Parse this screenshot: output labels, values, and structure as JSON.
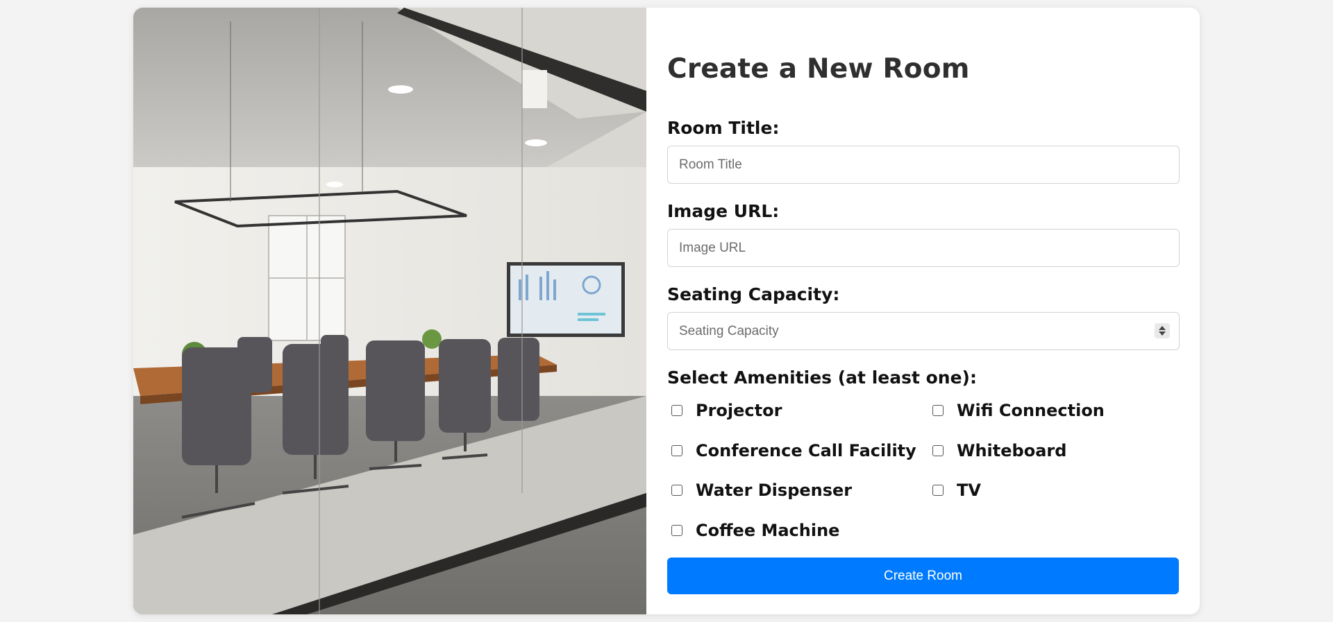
{
  "form": {
    "title": "Create a New Room",
    "room_title_label": "Room Title:",
    "room_title_placeholder": "Room Title",
    "image_url_label": "Image URL:",
    "image_url_placeholder": "Image URL",
    "seating_label": "Seating Capacity:",
    "seating_placeholder": "Seating Capacity",
    "amenities_label": "Select Amenities (at least one):",
    "amenities": [
      {
        "label": "Projector",
        "checked": false
      },
      {
        "label": "Wifi Connection",
        "checked": false
      },
      {
        "label": "Conference Call Facility",
        "checked": false
      },
      {
        "label": "Whiteboard",
        "checked": false
      },
      {
        "label": "Water Dispenser",
        "checked": false
      },
      {
        "label": "TV",
        "checked": false
      },
      {
        "label": "Coffee Machine",
        "checked": false
      }
    ],
    "submit_label": "Create Room"
  },
  "colors": {
    "accent": "#007bff",
    "background": "#f3f3f4",
    "card": "#ffffff"
  }
}
